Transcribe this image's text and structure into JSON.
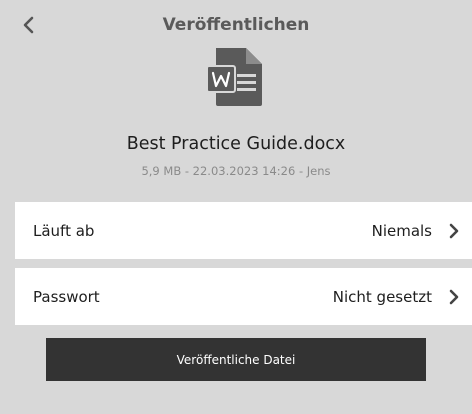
{
  "header": {
    "title": "Veröffentlichen"
  },
  "file": {
    "icon": "word-document-icon",
    "name": "Best Practice Guide.docx",
    "meta": "5,9 MB - 22.03.2023 14:26 - Jens"
  },
  "settings": [
    {
      "label": "Läuft ab",
      "value": "Niemals"
    },
    {
      "label": "Passwort",
      "value": "Nicht gesetzt"
    }
  ],
  "actions": {
    "publish_label": "Veröffentliche Datei"
  },
  "colors": {
    "background": "#d8d8d8",
    "icon": "#5a5a5a",
    "button": "#333333"
  }
}
